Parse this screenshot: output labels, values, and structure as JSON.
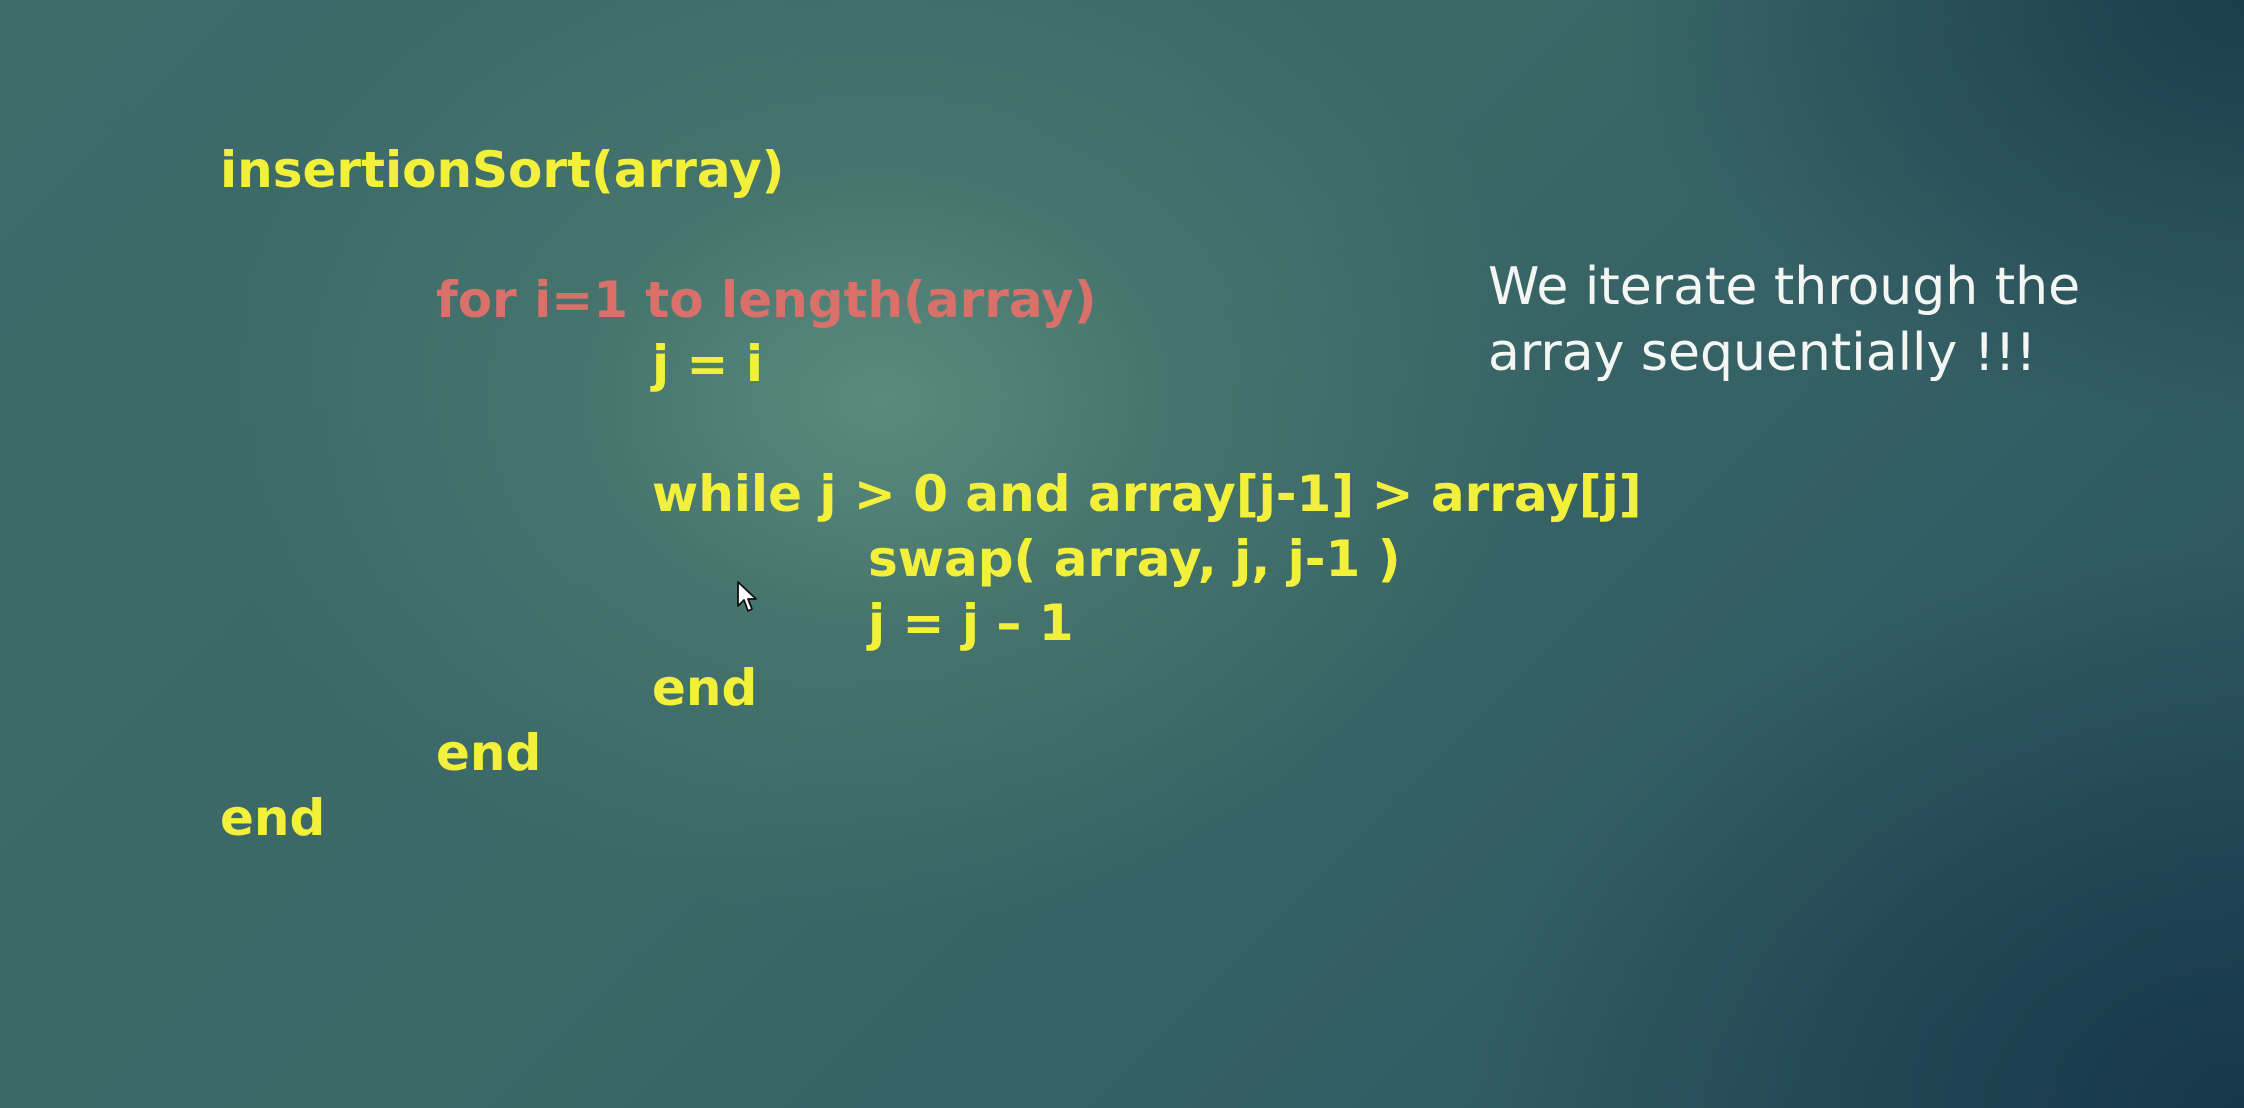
{
  "code": {
    "line1": "insertionSort(array)",
    "line2": "for i=1 to length(array)",
    "line3": "j = i",
    "line4": "while j > 0 and array[j-1] > array[j]",
    "line5": "swap( array, j, j-1 )",
    "line6": "j = j – 1",
    "line7": "end",
    "line8": "end",
    "line9": "end"
  },
  "note": {
    "line1": "We iterate through the",
    "line2": "array sequentially !!!"
  },
  "colors": {
    "code": "#f2f03a",
    "highlight": "#d9716a",
    "note": "#f4f6f4"
  },
  "icons": {
    "cursor": "mouse-pointer-icon"
  }
}
